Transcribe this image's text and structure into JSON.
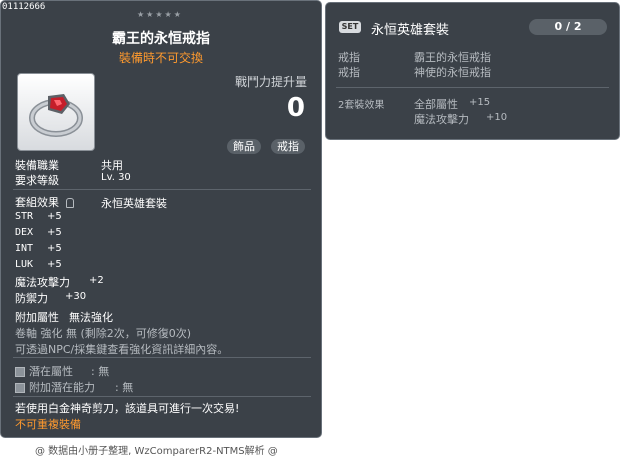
{
  "item": {
    "id": "01112666",
    "stars": "★★★★★",
    "name": "霸王的永恒戒指",
    "trade_note": "裝備時不可交換",
    "power_label": "戰鬥力提升量",
    "power_value": "0",
    "tags": [
      "飾品",
      "戒指"
    ],
    "job_label": "裝備職業",
    "job_value": "共用",
    "level_label": "要求等級",
    "level_value": "Lv. 30",
    "set_label": "套組效果",
    "set_value": "永恒英雄套裝",
    "stats": [
      {
        "name": "STR",
        "value": "+5"
      },
      {
        "name": "DEX",
        "value": "+5"
      },
      {
        "name": "INT",
        "value": "+5"
      },
      {
        "name": "LUK",
        "value": "+5"
      }
    ],
    "magic_attack_label": "魔法攻擊力",
    "magic_attack_value": "+2",
    "defense_label": "防禦力",
    "defense_value": "+30",
    "extra_label": "附加屬性",
    "extra_value": "無法強化",
    "scroll_line": "卷軸 強化 無 (剩除2次，可修復0次)",
    "hint_line": "可透過NPC/採集鍵查看強化資訊詳細內容。",
    "potential_label": "潛在屬性",
    "potential_value": ": 無",
    "add_potential_label": "附加潛在能力",
    "add_potential_value": ": 無",
    "cut_note": "若使用白金神奇剪刀，該道具可進行一次交易!",
    "no_duplicate": "不可重複裝備"
  },
  "set_panel": {
    "badge": "SET",
    "name": "永恒英雄套裝",
    "count": "0 / 2",
    "parts": [
      {
        "type": "戒指",
        "name": "霸王的永恒戒指"
      },
      {
        "type": "戒指",
        "name": "神使的永恒戒指"
      }
    ],
    "effect_label": "2套裝效果",
    "effects": [
      {
        "name": "全部屬性",
        "value": "+15"
      },
      {
        "name": "魔法攻擊力",
        "value": "+10"
      }
    ]
  },
  "footer": "@ 数据由小册子整理, WzComparerR2-NTMS解析 @",
  "colors": {
    "panel": "#3b4148",
    "accent": "#ff9a2e"
  }
}
